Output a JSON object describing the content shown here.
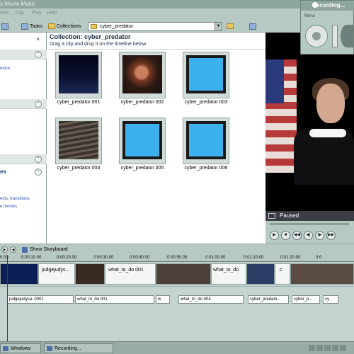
{
  "window": {
    "title": "s Movie Make"
  },
  "menu": [
    "ools",
    "Clip",
    "Play",
    "Help"
  ],
  "toolbar": {
    "tasks_label": "Tasks",
    "collections_label": "Collections",
    "collection_selected": "cyber_predator"
  },
  "left_panel": {
    "link1": "evice",
    "heading": "es",
    "link2": "ects, transitions",
    "link3": "e movies"
  },
  "collection": {
    "title": "Collection: cyber_predator",
    "subtitle": "Drag a clip and drop it on the timeline below.",
    "clips": [
      {
        "label": "cyber_predator 001",
        "kind": "dark"
      },
      {
        "label": "cyber_predator 002",
        "kind": "face"
      },
      {
        "label": "cyber_predator 003",
        "kind": "blue"
      },
      {
        "label": "cyber_predator 004",
        "kind": "keyb"
      },
      {
        "label": "cyber_predator 005",
        "kind": "blue"
      },
      {
        "label": "cyber_predator 006",
        "kind": "blue"
      }
    ]
  },
  "preview": {
    "status": "Paused"
  },
  "recording": {
    "title": "Recording...",
    "menu": "Menu"
  },
  "timeline": {
    "show_storyboard": "Show Storyboard",
    "ruler": [
      "0:00",
      "0:00:10.00",
      "0:00:20.00",
      "0:00:30.00",
      "0:00:40.00",
      "0:00:50.00",
      "0:01:00.00",
      "0:01:10.00",
      "0:01:20.00",
      "0:0"
    ],
    "video_labels": {
      "clip1": "judgejudys...",
      "clip2": "what_to_do 001",
      "clip3": "what_to_do",
      "clip4": "c"
    },
    "audio": [
      "judgejudysa..0001",
      "what_to_do 001",
      "w",
      "what_to_do 004",
      "cyber_predato...",
      "cyber_p...",
      "cy"
    ]
  },
  "taskbar": {
    "item1": "Windows Mo...",
    "item2": "Recording..."
  }
}
